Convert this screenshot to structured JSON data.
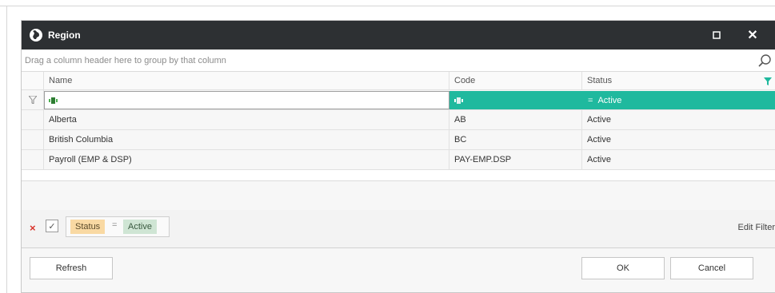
{
  "window": {
    "title": "Region",
    "maximize_icon": "□",
    "close_icon": "✕"
  },
  "group_panel": {
    "hint": "Drag a column header here to group by that column"
  },
  "grid": {
    "columns": [
      "Name",
      "Code",
      "Status"
    ],
    "auto_filter": {
      "status_operator": "=",
      "status_value": "Active"
    },
    "rows": [
      {
        "name": "Alberta",
        "code": "AB",
        "status": "Active"
      },
      {
        "name": "British Columbia",
        "code": "BC",
        "status": "Active"
      },
      {
        "name": "Payroll (EMP & DSP)",
        "code": "PAY-EMP.DSP",
        "status": "Active"
      }
    ]
  },
  "filter_panel": {
    "clear_icon": "×",
    "check_icon": "✓",
    "field": "Status",
    "operator": "=",
    "value": "Active",
    "edit_label": "Edit Filter"
  },
  "buttons": {
    "refresh": "Refresh",
    "ok": "OK",
    "cancel": "Cancel"
  },
  "colors": {
    "titlebar": "#2d3033",
    "accent": "#1fb99e",
    "filter_field": "#f9d9a3",
    "filter_value": "#cfe5d4",
    "clear_red": "#d9322a"
  }
}
